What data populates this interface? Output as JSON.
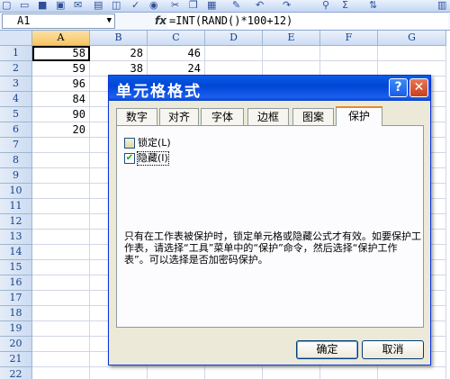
{
  "toolbar": {
    "icons": [
      "new-icon",
      "open-icon",
      "save-icon",
      "permission-icon",
      "email-icon",
      "print-icon",
      "print-preview-icon",
      "spelling-icon",
      "research-icon",
      "cut-icon",
      "copy-icon",
      "paste-icon",
      "format-painter-icon",
      "undo-icon",
      "redo-icon",
      "hyperlink-icon",
      "autosum-icon",
      "sort-ascending-icon",
      "chart-icon"
    ]
  },
  "formula_bar": {
    "name_box": "A1",
    "fx": "fx",
    "formula": "=INT(RAND()*100+12)"
  },
  "grid": {
    "columns": [
      "A",
      "B",
      "C",
      "D",
      "E",
      "F",
      "G"
    ],
    "rows": [
      "1",
      "2",
      "3",
      "4",
      "5",
      "6",
      "7",
      "8",
      "9",
      "10",
      "11",
      "12",
      "13",
      "14",
      "15",
      "16",
      "17",
      "18",
      "19",
      "20",
      "21",
      "22"
    ],
    "values": [
      [
        "58",
        "28",
        "46"
      ],
      [
        "59",
        "38",
        "24"
      ],
      [
        "96",
        "",
        ""
      ],
      [
        "84",
        "",
        ""
      ],
      [
        "90",
        "",
        ""
      ],
      [
        "20",
        "",
        ""
      ]
    ]
  },
  "dialog": {
    "title": "单元格格式",
    "help": "?",
    "close": "✕",
    "tabs": [
      "数字",
      "对齐",
      "字体",
      "边框",
      "图案",
      "保护"
    ],
    "active_tab": "保护",
    "lock_label": "锁定(L)",
    "lock_checked": false,
    "hide_label": "隐藏(I)",
    "hide_checked": true,
    "note": "只有在工作表被保护时，锁定单元格或隐藏公式才有效。如要保护工作表，请选择“工具”菜单中的“保护”命令，然后选择“保护工作表”。可以选择是否加密码保护。",
    "ok_label": "确定",
    "cancel_label": "取消"
  },
  "colors": {
    "title_bar": "#0a5ce8",
    "dialog_bg": "#ece9d8",
    "active_tab_accent": "#e68b2c"
  }
}
